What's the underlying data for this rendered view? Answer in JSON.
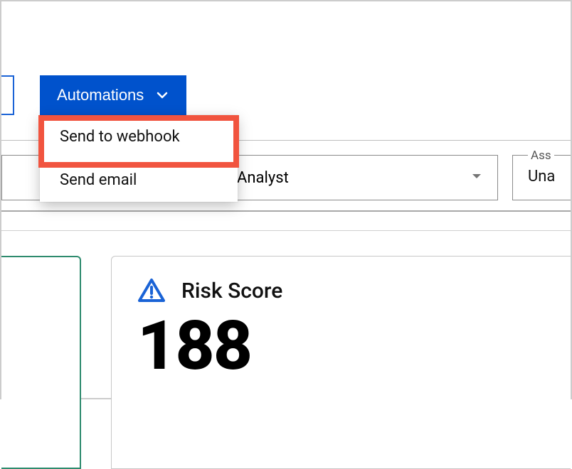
{
  "toolbar": {
    "automations_label": "Automations",
    "dropdown": {
      "items": [
        {
          "label": "Send to webhook"
        },
        {
          "label": "Send email"
        }
      ]
    }
  },
  "filters": {
    "analyst_fragment": "Analyst",
    "assign_label": "Ass",
    "assign_value": "Una"
  },
  "risk": {
    "title": "Risk Score",
    "value": "188"
  }
}
